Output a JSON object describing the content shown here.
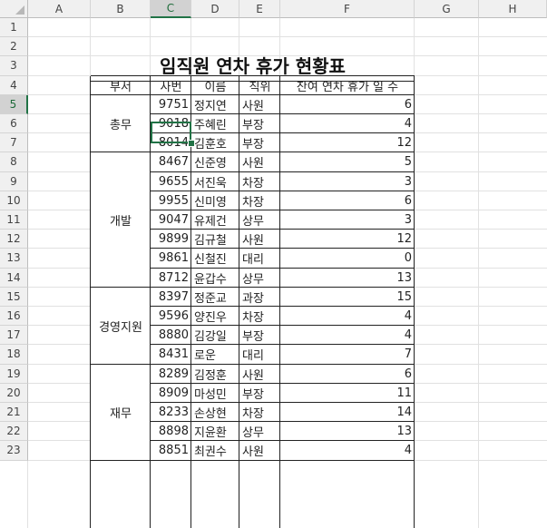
{
  "columns": [
    "A",
    "B",
    "C",
    "D",
    "E",
    "F",
    "G",
    "H"
  ],
  "rows": [
    "1",
    "2",
    "3",
    "4",
    "5",
    "6",
    "7",
    "8",
    "9",
    "10",
    "11",
    "12",
    "13",
    "14",
    "15",
    "16",
    "17",
    "18",
    "19",
    "20",
    "21",
    "22",
    "23"
  ],
  "selected_cell": {
    "column": "C",
    "row": "5"
  },
  "title": "임직원 연차 휴가 현황표",
  "headers": {
    "dept": "부서",
    "emp_id": "사번",
    "name": "이름",
    "position": "직위",
    "leave": "잔여 연차 휴가 일 수"
  },
  "departments": [
    {
      "name": "총무",
      "rows": 3
    },
    {
      "name": "개발",
      "rows": 7
    },
    {
      "name": "경영지원",
      "rows": 4
    },
    {
      "name": "재무",
      "rows": 5
    }
  ],
  "employees": [
    {
      "id": "9751",
      "name": "정지연",
      "position": "사원",
      "leave": "6"
    },
    {
      "id": "9018",
      "name": "주혜린",
      "position": "부장",
      "leave": "4"
    },
    {
      "id": "8014",
      "name": "김훈호",
      "position": "부장",
      "leave": "12"
    },
    {
      "id": "8467",
      "name": "신준영",
      "position": "사원",
      "leave": "5"
    },
    {
      "id": "9655",
      "name": "서진욱",
      "position": "차장",
      "leave": "3"
    },
    {
      "id": "9955",
      "name": "신미영",
      "position": "차장",
      "leave": "6"
    },
    {
      "id": "9047",
      "name": "유제건",
      "position": "상무",
      "leave": "3"
    },
    {
      "id": "9899",
      "name": "김규철",
      "position": "사원",
      "leave": "12"
    },
    {
      "id": "9861",
      "name": "신철진",
      "position": "대리",
      "leave": "0"
    },
    {
      "id": "8712",
      "name": "윤갑수",
      "position": "상무",
      "leave": "13"
    },
    {
      "id": "8397",
      "name": "정준교",
      "position": "과장",
      "leave": "15"
    },
    {
      "id": "9596",
      "name": "양진우",
      "position": "차장",
      "leave": "4"
    },
    {
      "id": "8880",
      "name": "김강일",
      "position": "부장",
      "leave": "4"
    },
    {
      "id": "8431",
      "name": "로운",
      "position": "대리",
      "leave": "7"
    },
    {
      "id": "8289",
      "name": "김정훈",
      "position": "사원",
      "leave": "6"
    },
    {
      "id": "8909",
      "name": "마성민",
      "position": "부장",
      "leave": "11"
    },
    {
      "id": "8233",
      "name": "손상현",
      "position": "차장",
      "leave": "14"
    },
    {
      "id": "8898",
      "name": "지윤환",
      "position": "상무",
      "leave": "13"
    },
    {
      "id": "8851",
      "name": "최권수",
      "position": "사원",
      "leave": "4"
    }
  ]
}
